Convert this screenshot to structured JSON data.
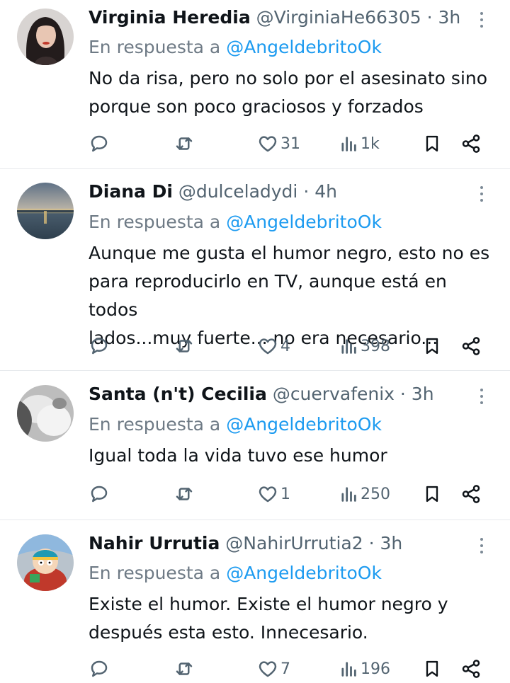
{
  "reply_prefix": "En respuesta a",
  "tweets": [
    {
      "name": "Virginia Heredia",
      "handle": "@VirginiaHe66305",
      "time": "· 3h",
      "reply_to": "@AngeldebritoOk",
      "text": "No da risa, pero no solo por el asesinato sino\nporque son poco graciosos y forzados",
      "likes": "31",
      "views": "1k",
      "avatar_icon": "woman-portrait"
    },
    {
      "name": "Diana Di",
      "handle": "@dulceladydi",
      "time": "· 4h",
      "reply_to": "@AngeldebritoOk",
      "text": "Aunque me gusta el humor negro, esto no es\npara reproducirlo en TV, aunque está en todos\nlados...muy fuerte... no era necesario...",
      "likes": "4",
      "views": "398",
      "avatar_icon": "sunset-lake"
    },
    {
      "name": "Santa (n't) Cecilia",
      "handle": "@cuervafenix",
      "time": "· 3h",
      "reply_to": "@AngeldebritoOk",
      "text": "Igual toda la vida tuvo ese humor",
      "likes": "1",
      "views": "250",
      "avatar_icon": "grayscale-photo"
    },
    {
      "name": "Nahir Urrutia",
      "handle": "@NahirUrrutia2",
      "time": "· 3h",
      "reply_to": "@AngeldebritoOk",
      "text": "Existe el humor. Existe el humor negro y\ndespués esta esto.  Innecesario.",
      "likes": "7",
      "views": "196",
      "avatar_icon": "cartoon-character"
    }
  ],
  "colors": {
    "link": "#1d9bf0",
    "muted": "#536471",
    "text": "#0f1419",
    "divider": "#e6e9ec"
  }
}
